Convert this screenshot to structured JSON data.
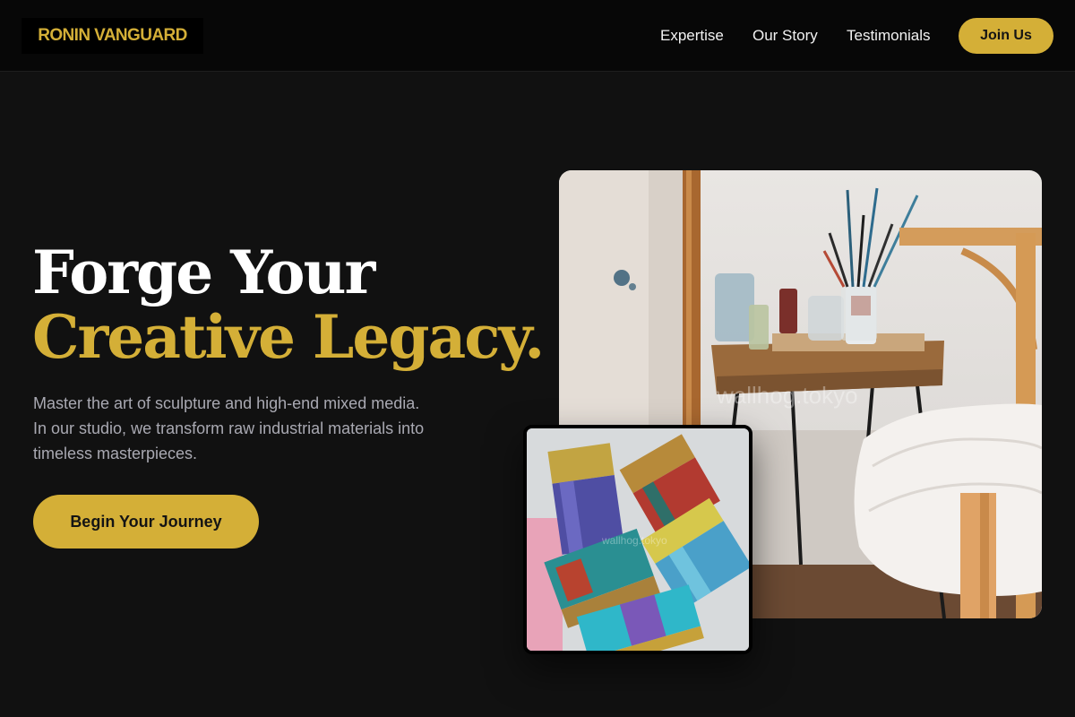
{
  "header": {
    "logo": "RONIN VANGUARD",
    "nav": [
      "Expertise",
      "Our Story",
      "Testimonials"
    ],
    "join_label": "Join Us"
  },
  "hero": {
    "headline_line1": "Forge Your",
    "headline_line2": "Creative Legacy.",
    "description": "Master the art of sculpture and high-end mixed media. In our studio, we transform raw industrial materials into timeless masterpieces.",
    "cta_label": "Begin Your Journey"
  },
  "images": {
    "studio_watermark": "wallhog.tokyo",
    "brushes_watermark": "wallhog.tokyo"
  },
  "colors": {
    "accent": "#d4af37",
    "background": "#111111",
    "header_background": "#070707",
    "body_text": "#a9a9b2"
  }
}
